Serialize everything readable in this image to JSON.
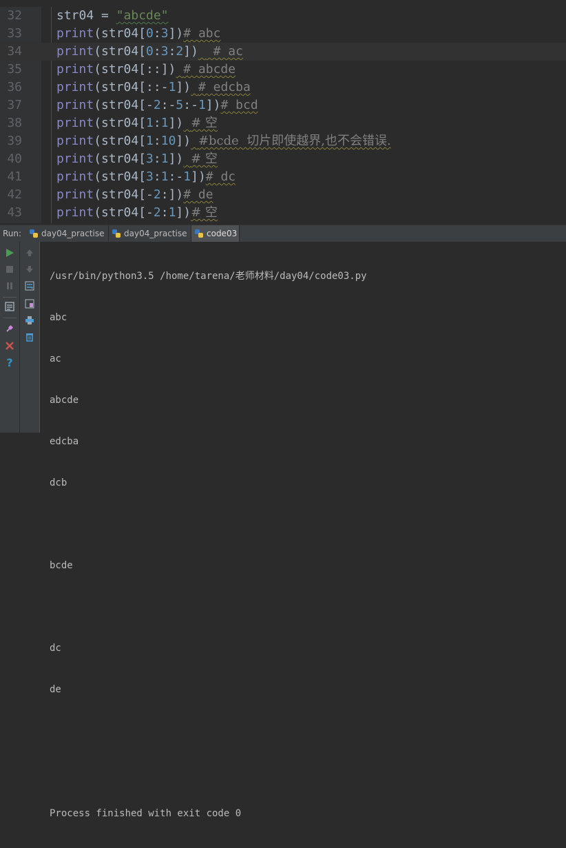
{
  "editor": {
    "lines": [
      {
        "num": "32",
        "parts": [
          [
            "p",
            "str04 = "
          ],
          [
            "s",
            "\"abcde\""
          ]
        ]
      },
      {
        "num": "33",
        "parts": [
          [
            "k",
            "print"
          ],
          [
            "p",
            "(str04["
          ],
          [
            "n",
            "0"
          ],
          [
            "p",
            ":"
          ],
          [
            "n",
            "3"
          ],
          [
            "p",
            "])"
          ],
          [
            "c",
            "# abc"
          ]
        ]
      },
      {
        "num": "34",
        "parts": [
          [
            "k",
            "print"
          ],
          [
            "p",
            "(str04["
          ],
          [
            "n",
            "0"
          ],
          [
            "p",
            ":"
          ],
          [
            "n",
            "3"
          ],
          [
            "p",
            ":"
          ],
          [
            "n",
            "2"
          ],
          [
            "p",
            "])"
          ],
          [
            "w",
            " "
          ],
          [
            "c",
            " # ac"
          ]
        ]
      },
      {
        "num": "35",
        "parts": [
          [
            "k",
            "print"
          ],
          [
            "p",
            "(str04[::])"
          ],
          [
            "w",
            " "
          ],
          [
            "c",
            "# abcde"
          ]
        ]
      },
      {
        "num": "36",
        "parts": [
          [
            "k",
            "print"
          ],
          [
            "p",
            "(str04[::-"
          ],
          [
            "n",
            "1"
          ],
          [
            "p",
            "])"
          ],
          [
            "w",
            " "
          ],
          [
            "c",
            "# edcba"
          ]
        ]
      },
      {
        "num": "37",
        "parts": [
          [
            "k",
            "print"
          ],
          [
            "p",
            "(str04[-"
          ],
          [
            "n",
            "2"
          ],
          [
            "p",
            ":-"
          ],
          [
            "n",
            "5"
          ],
          [
            "p",
            ":-"
          ],
          [
            "n",
            "1"
          ],
          [
            "p",
            "])"
          ],
          [
            "c",
            "# bcd"
          ]
        ]
      },
      {
        "num": "38",
        "parts": [
          [
            "k",
            "print"
          ],
          [
            "p",
            "(str04["
          ],
          [
            "n",
            "1"
          ],
          [
            "p",
            ":"
          ],
          [
            "n",
            "1"
          ],
          [
            "p",
            "])"
          ],
          [
            "w",
            " "
          ],
          [
            "c",
            "# 空"
          ]
        ]
      },
      {
        "num": "39",
        "parts": [
          [
            "k",
            "print"
          ],
          [
            "p",
            "(str04["
          ],
          [
            "n",
            "1"
          ],
          [
            "p",
            ":"
          ],
          [
            "n",
            "10"
          ],
          [
            "p",
            "])"
          ],
          [
            "w",
            " "
          ],
          [
            "c",
            "#bcde  切片即使越界,也不会错误."
          ]
        ]
      },
      {
        "num": "40",
        "parts": [
          [
            "k",
            "print"
          ],
          [
            "p",
            "(str04["
          ],
          [
            "n",
            "3"
          ],
          [
            "p",
            ":"
          ],
          [
            "n",
            "1"
          ],
          [
            "p",
            "])"
          ],
          [
            "w",
            " "
          ],
          [
            "c",
            "# 空"
          ]
        ]
      },
      {
        "num": "41",
        "parts": [
          [
            "k",
            "print"
          ],
          [
            "p",
            "(str04["
          ],
          [
            "n",
            "3"
          ],
          [
            "p",
            ":"
          ],
          [
            "n",
            "1"
          ],
          [
            "p",
            ":-"
          ],
          [
            "n",
            "1"
          ],
          [
            "p",
            "])"
          ],
          [
            "c",
            "# dc"
          ]
        ]
      },
      {
        "num": "42",
        "parts": [
          [
            "k",
            "print"
          ],
          [
            "p",
            "(str04[-"
          ],
          [
            "n",
            "2"
          ],
          [
            "p",
            ":])"
          ],
          [
            "c",
            "# de"
          ]
        ]
      },
      {
        "num": "43",
        "parts": [
          [
            "k",
            "print"
          ],
          [
            "p",
            "(str04[-"
          ],
          [
            "n",
            "2"
          ],
          [
            "p",
            ":"
          ],
          [
            "n",
            "1"
          ],
          [
            "p",
            "])"
          ],
          [
            "c",
            "# 空"
          ]
        ]
      }
    ],
    "current_line": "34"
  },
  "run_bar": {
    "label": "Run:",
    "tabs": [
      {
        "label": "day04_practise",
        "active": false
      },
      {
        "label": "day04_practise",
        "active": false
      },
      {
        "label": "code03",
        "active": true
      }
    ]
  },
  "console": {
    "lines": [
      "/usr/bin/python3.5 /home/tarena/老师材料/day04/code03.py",
      "abc",
      "ac",
      "abcde",
      "edcba",
      "dcb",
      "",
      "bcde",
      "",
      "dc",
      "de",
      "",
      "",
      "Process finished with exit code 0"
    ]
  },
  "toolbar_left": [
    "run-icon",
    "stop-icon",
    "pause-icon",
    "layout-icon",
    "pin-icon",
    "close-icon",
    "help-icon"
  ],
  "toolbar_right": [
    "up-icon",
    "down-icon",
    "soft-wrap-icon",
    "scroll-to-end-icon",
    "print-icon",
    "trash-icon"
  ],
  "colors": {
    "run": "#499c54",
    "close": "#c75450",
    "help": "#3592c4"
  }
}
